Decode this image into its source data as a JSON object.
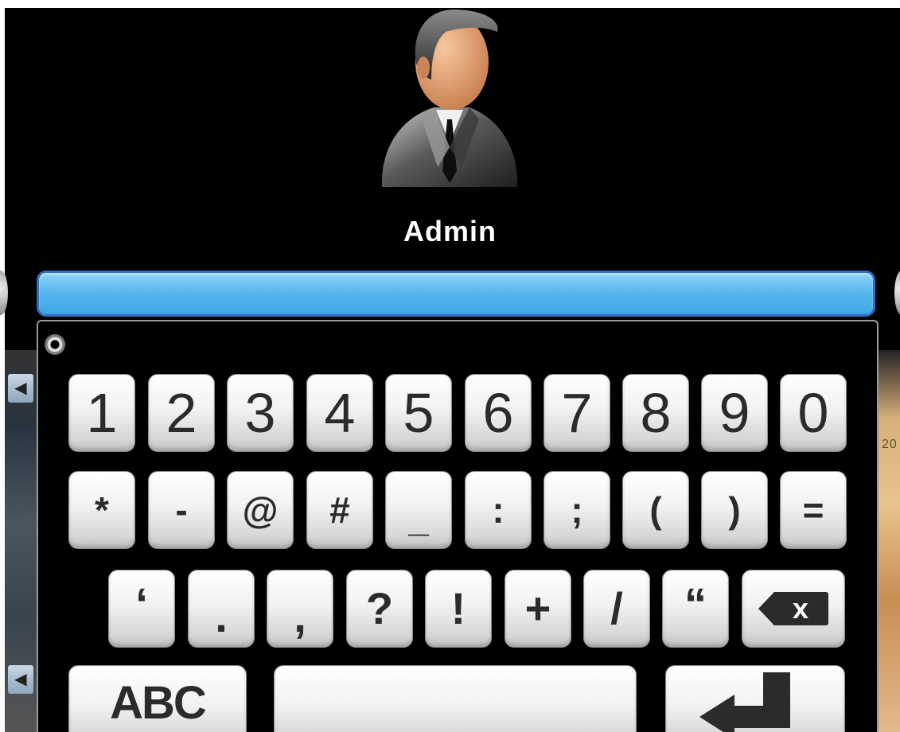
{
  "user": {
    "name": "Admin",
    "avatar_icon": "user-avatar-icon"
  },
  "password_field": {
    "value": "",
    "placeholder": ""
  },
  "keyboard": {
    "panel_icon": "keyboard-settings-icon",
    "row1": [
      "1",
      "2",
      "3",
      "4",
      "5",
      "6",
      "7",
      "8",
      "9",
      "0"
    ],
    "row2": [
      "*",
      "-",
      "@",
      "#",
      "_",
      ":",
      ";",
      "(",
      ")",
      "="
    ],
    "row3": [
      "‘",
      ".",
      ",",
      "?",
      "!",
      "+",
      "/",
      "“"
    ],
    "backspace_label": "x",
    "backspace_icon": "backspace-icon",
    "mode_label": "ABC",
    "space_label": "",
    "enter_icon": "enter-icon"
  },
  "background": {
    "left_icon": "speaker-icon",
    "right_text": "20"
  },
  "colors": {
    "field_blue": "#55b6ee",
    "field_border": "#2e6fbf",
    "key_text": "#2b2b2b",
    "background": "#000000"
  }
}
